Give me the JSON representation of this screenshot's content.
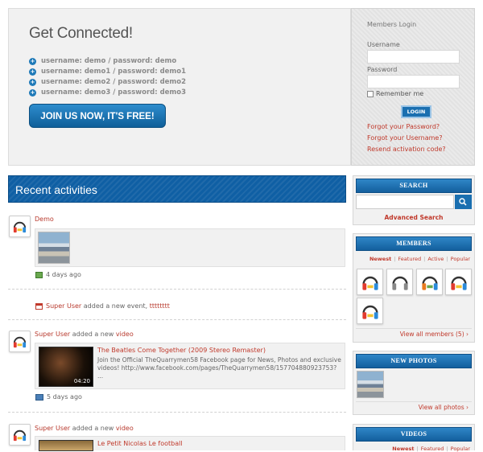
{
  "hero": {
    "title": "Get Connected!",
    "credentials": [
      "username: demo / password: demo",
      "username: demo1 / password: demo1",
      "username: demo2 / password: demo2",
      "username: demo3 / password: demo3"
    ],
    "join_label": "JOIN US NOW, IT'S FREE!"
  },
  "login": {
    "title": "Members Login",
    "username_label": "Username",
    "password_label": "Password",
    "remember_label": "Remember me",
    "button_label": "LOGIN",
    "forgot_password": "Forgot your Password?",
    "forgot_username": "Forgot your Username?",
    "resend_activation": "Resend activation code?"
  },
  "activity": {
    "header": "Recent activities",
    "items": [
      {
        "user": "Demo",
        "time": "4 days ago"
      },
      {
        "user": "Super User",
        "text": " added a new event, ",
        "target": "tttttttt"
      },
      {
        "user": "Super User",
        "text": " added a new ",
        "target": "video",
        "video_title": "The Beatles Come Together (2009 Stereo Remaster)",
        "video_desc": "Join the Official TheQuarrymen58 Facebook page for News, Photos and exclusive videos! http://www.facebook.com/pages/TheQuarrymen58/157704880923753? ...",
        "duration": "04:20",
        "time": "5 days ago"
      },
      {
        "user": "Super User",
        "text": " added a new ",
        "target": "video",
        "video_title": "Le Petit Nicolas Le football"
      }
    ]
  },
  "sidebar": {
    "search": {
      "title": "SEARCH",
      "placeholder": "",
      "advanced": "Advanced Search"
    },
    "members": {
      "title": "MEMBERS",
      "tabs": [
        "Newest",
        "Featured",
        "Active",
        "Popular"
      ],
      "footer": "View all members (5) ›"
    },
    "photos": {
      "title": "NEW PHOTOS",
      "footer": "View all photos ›"
    },
    "videos": {
      "title": "VIDEOS",
      "tabs": [
        "Newest",
        "Featured",
        "Popular"
      ]
    }
  },
  "colors": {
    "accent": "#135f9d",
    "link": "#c0392b"
  }
}
